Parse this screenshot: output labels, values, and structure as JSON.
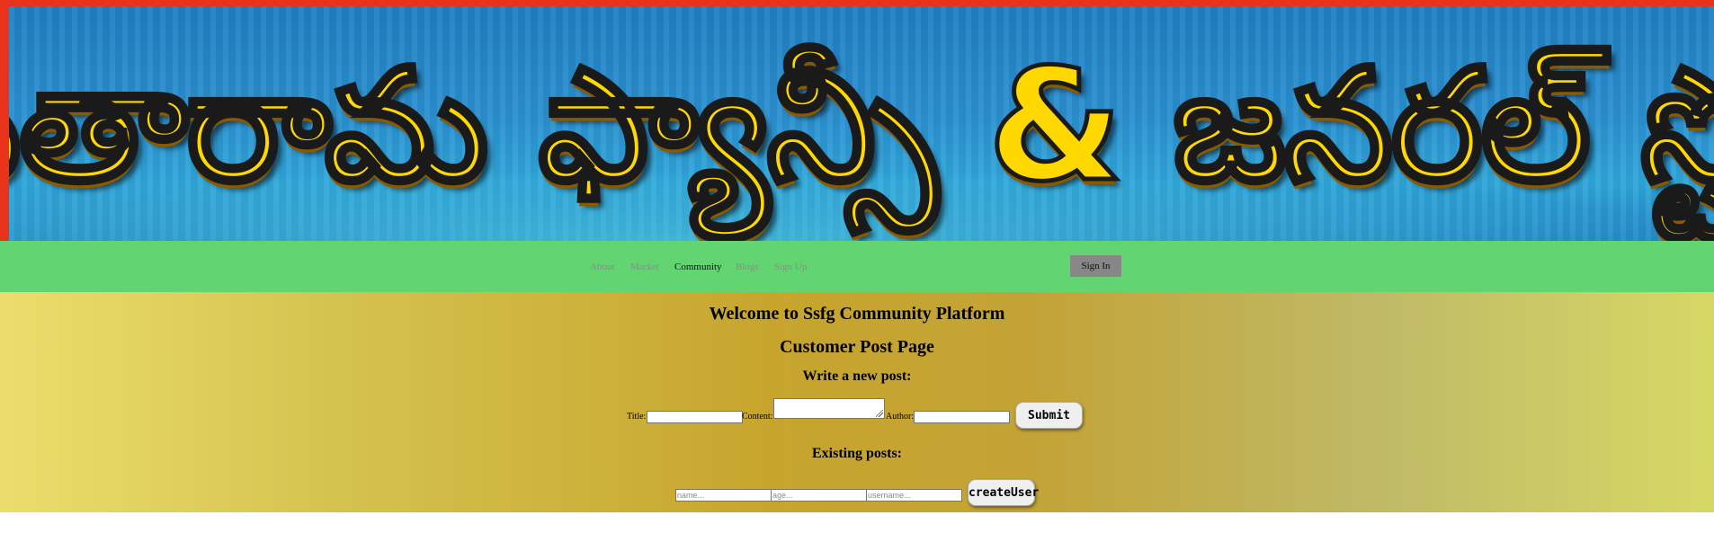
{
  "banner": {
    "title": "శ్రీ సీతారామ ఫ్యాన్సీ & జనరల్ స్టోర్స్"
  },
  "nav": {
    "links": [
      {
        "label": "About"
      },
      {
        "label": "Market"
      },
      {
        "label": "Community",
        "active": true
      },
      {
        "label": "Blogs"
      },
      {
        "label": "Sign Up"
      }
    ],
    "signin_label": "Sign In"
  },
  "main": {
    "welcome": "Welcome to Ssfg Community Platform",
    "page_title": "Customer Post Page",
    "new_post_heading": "Write a new post:",
    "form": {
      "title_label": "Title:",
      "content_label": "Content:",
      "author_label": "Author:",
      "submit_label": "Submit"
    },
    "existing_heading": "Existing posts:",
    "user_form": {
      "name_placeholder": "name...",
      "age_placeholder": "age...",
      "username_placeholder": "username...",
      "create_label": "createUser"
    }
  },
  "colors": {
    "banner_border": "#e8321a",
    "banner_bg": "#2a8fcf",
    "banner_text": "#ffd800",
    "nav_bg": "#62d472",
    "nav_link": "#8b8b8b",
    "nav_active": "#111111",
    "signin_bg": "#878787"
  }
}
